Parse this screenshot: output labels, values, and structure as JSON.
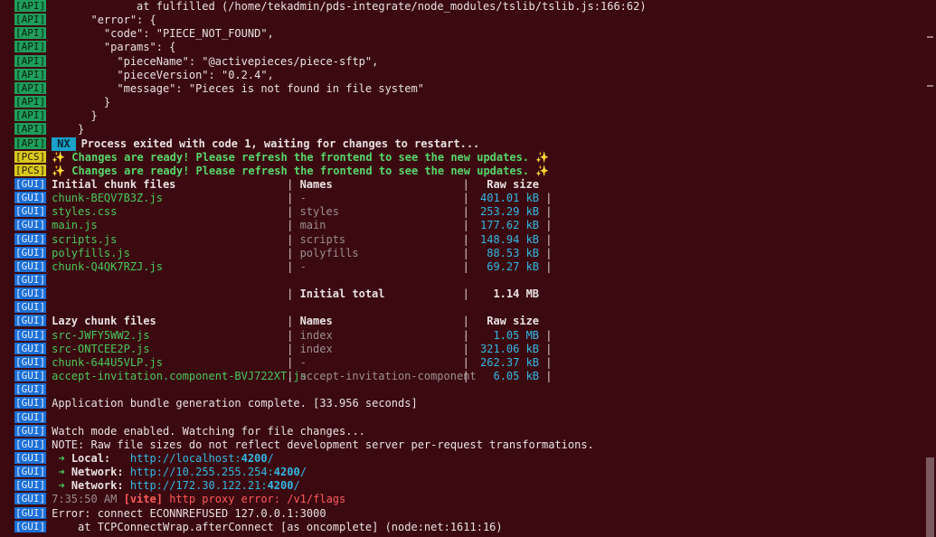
{
  "tags": {
    "api": "[API]",
    "pcs": "[PCS]",
    "gui": "[GUI]"
  },
  "api_lines": [
    "             at fulfilled (/home/tekadmin/pds-integrate/node_modules/tslib/tslib.js:166:62)",
    "      \"error\": {",
    "        \"code\": \"PIECE_NOT_FOUND\",",
    "        \"params\": {",
    "          \"pieceName\": \"@activepieces/piece-sftp\",",
    "          \"pieceVersion\": \"0.2.4\",",
    "          \"message\": \"Pieces is not found in file system\"",
    "        }",
    "      }",
    "    }"
  ],
  "nx_badge": "NX",
  "nx_message": "Process exited with code 1, waiting for changes to restart...",
  "pcs_message": "✨ Changes are ready! Please refresh the frontend to see the new updates. ✨",
  "initial_table": {
    "headers": [
      "Initial chunk files",
      "Names",
      "Raw size"
    ],
    "rows": [
      [
        "chunk-BEQV7B3Z.js",
        "-",
        "401.01 kB"
      ],
      [
        "styles.css",
        "styles",
        "253.29 kB"
      ],
      [
        "main.js",
        "main",
        "177.62 kB"
      ],
      [
        "scripts.js",
        "scripts",
        "148.94 kB"
      ],
      [
        "polyfills.js",
        "polyfills",
        "88.53 kB"
      ],
      [
        "chunk-Q4QK7RZJ.js",
        "-",
        "69.27 kB"
      ]
    ],
    "total_label": "Initial total",
    "total_value": "1.14 MB"
  },
  "lazy_table": {
    "headers": [
      "Lazy chunk files",
      "Names",
      "Raw size"
    ],
    "rows": [
      [
        "src-JWFY5WW2.js",
        "index",
        "1.05 MB"
      ],
      [
        "src-ONTCEE2P.js",
        "index",
        "321.06 kB"
      ],
      [
        "chunk-644U5VLP.js",
        "-",
        "262.37 kB"
      ],
      [
        "accept-invitation.component-BVJ722XT.js",
        "accept-invitation-component",
        "6.05 kB"
      ]
    ]
  },
  "bundle_complete": "Application bundle generation complete. [33.956 seconds]",
  "watch_mode": "Watch mode enabled. Watching for file changes...",
  "note": "NOTE: Raw file sizes do not reflect development server per-request transformations.",
  "servers": [
    {
      "arrow": "➜",
      "label": "Local:",
      "url_prefix": "http://localhost:",
      "port": "4200",
      "suffix": "/"
    },
    {
      "arrow": "➜",
      "label": "Network:",
      "url_prefix": "http://10.255.255.254:",
      "port": "4200",
      "suffix": "/"
    },
    {
      "arrow": "➜",
      "label": "Network:",
      "url_prefix": "http://172.30.122.21:",
      "port": "4200",
      "suffix": "/"
    }
  ],
  "proxy_error": {
    "time": "7:35:50 AM",
    "source": "[vite]",
    "message": "http proxy error: /v1/flags"
  },
  "econn_error": "Error: connect ECONNREFUSED 127.0.0.1:3000",
  "econn_stack": "    at TCPConnectWrap.afterConnect [as oncomplete] (node:net:1611:16)"
}
